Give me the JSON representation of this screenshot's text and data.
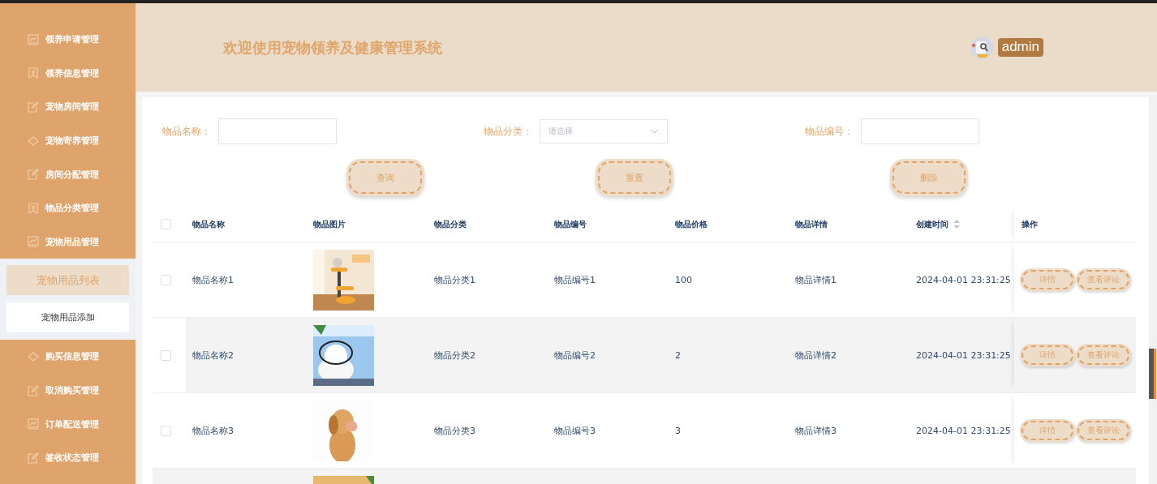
{
  "sidebar": {
    "items": [
      {
        "label": "领养申请管理"
      },
      {
        "label": "领养信息管理"
      },
      {
        "label": "宠物房间管理"
      },
      {
        "label": "宠物寄养管理"
      },
      {
        "label": "房间分配管理"
      },
      {
        "label": "物品分类管理"
      },
      {
        "label": "宠物用品管理",
        "children": [
          {
            "label": "宠物用品列表",
            "selected": true
          },
          {
            "label": "宠物用品添加",
            "selected": false
          }
        ]
      },
      {
        "label": "购买信息管理"
      },
      {
        "label": "取消购买管理"
      },
      {
        "label": "订单配送管理"
      },
      {
        "label": "签收状态管理"
      }
    ]
  },
  "header": {
    "title": "欢迎使用宠物领养及健康管理系统",
    "user": "admin"
  },
  "search": {
    "fields": [
      {
        "label": "物品名称：",
        "kind": "text"
      },
      {
        "label": "物品分类：",
        "kind": "select",
        "placeholder": "请选择"
      },
      {
        "label": "物品编号：",
        "kind": "text"
      }
    ],
    "buttons": [
      "查询",
      "重置",
      "删除"
    ]
  },
  "table": {
    "columns": [
      "物品名称",
      "物品图片",
      "物品分类",
      "物品编号",
      "物品价格",
      "物品详情",
      "创建时间",
      "操作"
    ],
    "all_selected": false,
    "rows": [
      {
        "selected": false,
        "name": "物品名称1",
        "picture": {
          "kind": "picture"
        },
        "category": "物品分类1",
        "code": "物品编号1",
        "price": "100",
        "detail": "物品详情1",
        "created": "2024-04-01 23:31:25",
        "actions": [
          "详情",
          "查看评论"
        ]
      },
      {
        "selected": false,
        "name": "物品名称2",
        "picture": {
          "kind": "picture"
        },
        "category": "物品分类2",
        "code": "物品编号2",
        "price": "2",
        "detail": "物品详情2",
        "created": "2024-04-01 23:31:25",
        "actions": [
          "详情",
          "查看评论"
        ]
      },
      {
        "selected": false,
        "name": "物品名称3",
        "picture": {
          "kind": "picture"
        },
        "category": "物品分类3",
        "code": "物品编号3",
        "price": "3",
        "detail": "物品详情3",
        "created": "2024-04-01 23:31:25",
        "actions": [
          "详情",
          "查看评论"
        ]
      },
      {
        "picture": {
          "kind": "picture"
        }
      }
    ]
  }
}
